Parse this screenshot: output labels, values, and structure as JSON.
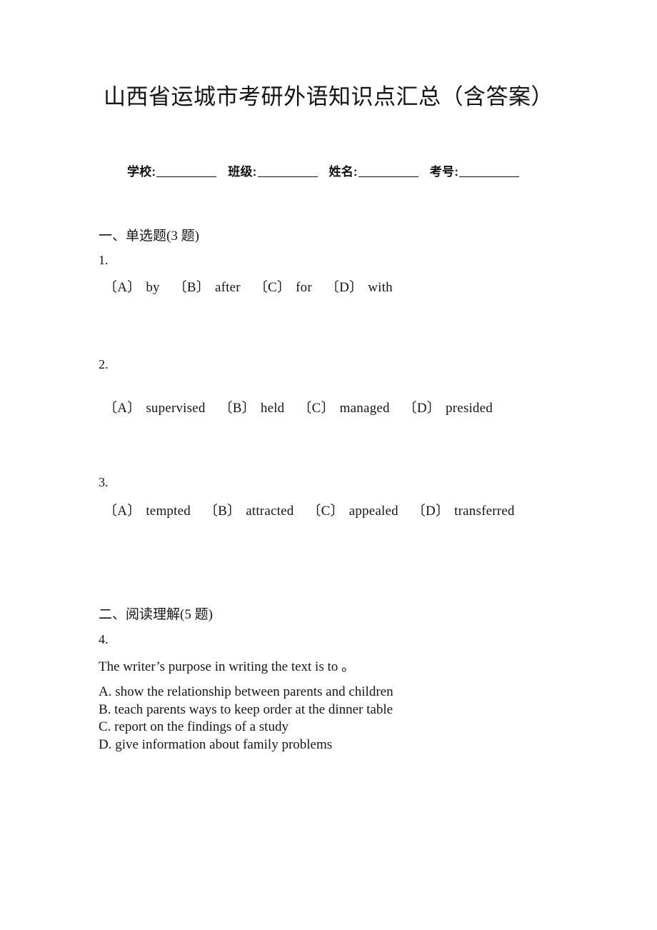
{
  "document": {
    "title": "山西省运城市考研外语知识点汇总（含答案）",
    "info_fields": [
      {
        "label": "学校:"
      },
      {
        "label": "班级:"
      },
      {
        "label": "姓名:"
      },
      {
        "label": "考号:"
      }
    ]
  },
  "sections": [
    {
      "heading": "一、单选题(3 题)",
      "questions": [
        {
          "number": "1.",
          "stem": "",
          "options_inline": [
            {
              "key": "〔A〕",
              "text": "by"
            },
            {
              "key": "〔B〕",
              "text": "after"
            },
            {
              "key": "〔C〕",
              "text": "for"
            },
            {
              "key": "〔D〕",
              "text": "with"
            }
          ]
        },
        {
          "number": "2.",
          "stem": "",
          "options_inline": [
            {
              "key": "〔A〕",
              "text": "supervised"
            },
            {
              "key": "〔B〕",
              "text": "held"
            },
            {
              "key": "〔C〕",
              "text": "managed"
            },
            {
              "key": "〔D〕",
              "text": "presided"
            }
          ]
        },
        {
          "number": "3.",
          "stem": "",
          "options_inline": [
            {
              "key": "〔A〕",
              "text": "tempted"
            },
            {
              "key": "〔B〕",
              "text": "attracted"
            },
            {
              "key": "〔C〕",
              "text": "appealed"
            },
            {
              "key": "〔D〕",
              "text": "transferred"
            }
          ]
        }
      ]
    },
    {
      "heading": "二、阅读理解(5 题)",
      "questions": [
        {
          "number": "4.",
          "stem": "The writer’s purpose in writing the text is to  。",
          "options_stacked": [
            "A. show the relationship between parents and children",
            "B. teach parents ways to keep order at the dinner table",
            "C. report on the findings of a study",
            "D. give information about family problems"
          ]
        }
      ]
    }
  ]
}
